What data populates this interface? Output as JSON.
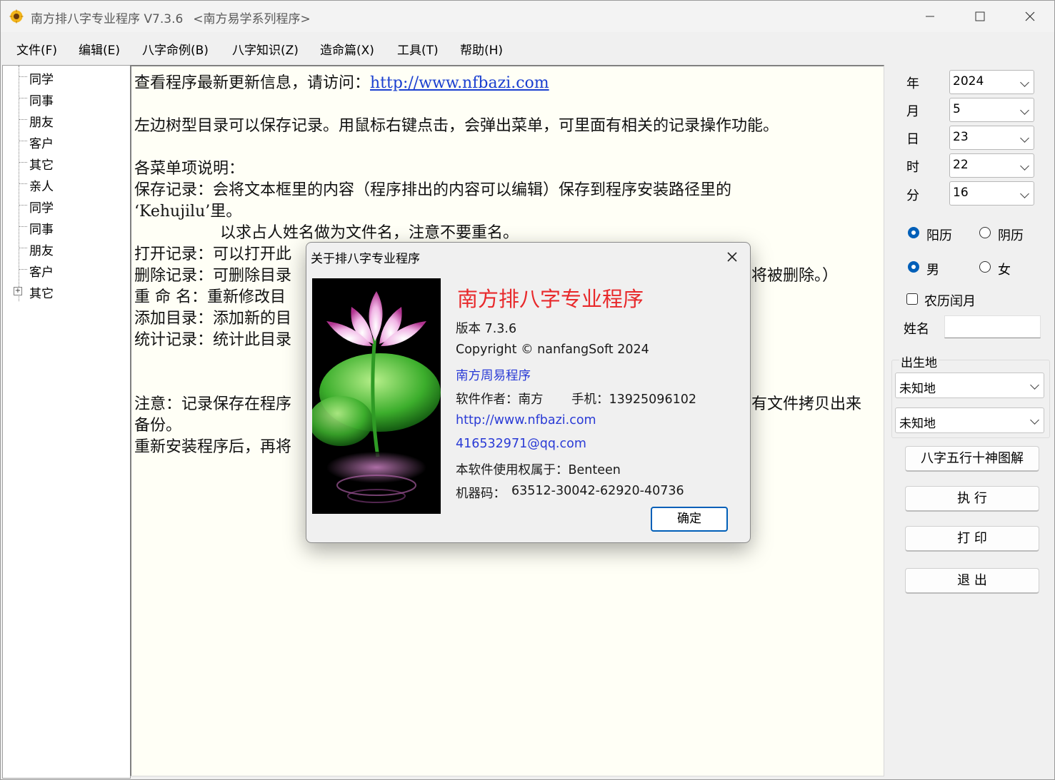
{
  "window": {
    "title": "南方排八字专业程序 V7.3.6",
    "subtitle": "<南方易学系列程序>"
  },
  "menu": [
    "文件(F)",
    "编辑(E)",
    "八字命例(B)",
    "八字知识(Z)",
    "造命篇(X)",
    "工具(T)",
    "帮助(H)"
  ],
  "tree": {
    "items": [
      "同学",
      "同事",
      "朋友",
      "客户",
      "其它",
      "亲人",
      "同学",
      "同事",
      "朋友",
      "客户",
      "其它"
    ]
  },
  "text": {
    "line1_prefix": "查看程序最新更新信息，请访问：",
    "line1_link": "http://www.nfbazi.com",
    "line2": "左边树型目录可以保存记录。用鼠标右键点击，会弹出菜单，可里面有相关的记录操作功能。",
    "line3": "各菜单项说明：",
    "line4": "保存记录：会将文本框里的内容（程序排出的内容可以编辑）保存到程序安装路径里的",
    "line5": "‘Kehujilu’里。",
    "line6": "以求占人姓名做为文件名，注意不要重名。",
    "line7": "打开记录：可以打开此",
    "line8": "删除记录：可删除目录",
    "line8_tail": "将被删除。）",
    "line9": "重 命 名：重新修改目",
    "line10": "添加目录：添加新的目",
    "line11": "统计记录：统计此目录",
    "line12": "注意：记录保存在程序",
    "line12_tail": "有文件拷贝出来",
    "line13": "备份。",
    "line14": "重新安装程序后，再将"
  },
  "panel": {
    "year_label": "年",
    "year": "2024",
    "month_label": "月",
    "month": "5",
    "day_label": "日",
    "day": "23",
    "hour_label": "时",
    "hour": "22",
    "minute_label": "分",
    "minute": "16",
    "solar": "阳历",
    "lunar": "阴历",
    "male": "男",
    "female": "女",
    "leap_month": "农历闰月",
    "name_label": "姓名",
    "name_value": "",
    "birthplace_label": "出生地",
    "birthplace1": "未知地",
    "birthplace2": "未知地",
    "btn_chart": "八字五行十神图解",
    "btn_run": "执 行",
    "btn_print": "打 印",
    "btn_exit": "退 出"
  },
  "dialog": {
    "title": "关于排八字专业程序",
    "app_name": "南方排八字专业程序",
    "version": "版本 7.3.6",
    "copyright": "Copyright © nanfangSoft 2024",
    "series": "南方周易程序",
    "author_label": "软件作者：南方",
    "phone_label": "手机：13925096102",
    "url": "http://www.nfbazi.com",
    "email": "416532971@qq.com",
    "license": "本软件使用权属于：Benteen",
    "machine_label": "机器码：",
    "machine_code": "63512-30042-62920-40736",
    "ok": "确定"
  },
  "colors": {
    "accent": "#005fb8",
    "dialog_title_red": "#e8292b",
    "link_blue": "#2a3bd6",
    "text_bg": "#fffff6"
  }
}
